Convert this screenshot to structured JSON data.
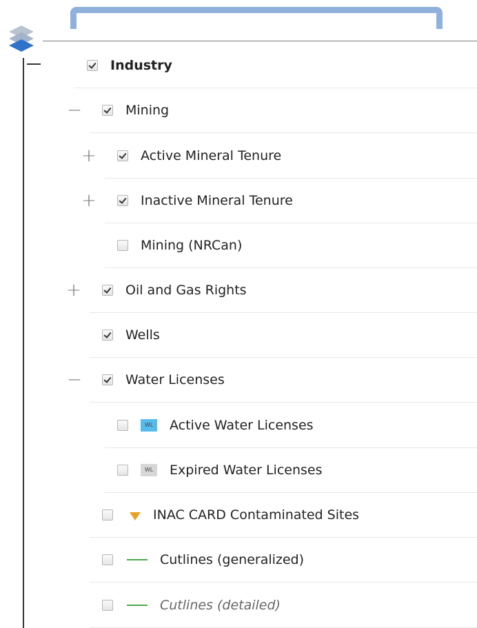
{
  "tree": {
    "root": {
      "label": "Industry",
      "checked": true
    },
    "items": [
      {
        "label": "Mining",
        "checked": true,
        "expander": "minus"
      },
      {
        "label": "Active Mineral Tenure",
        "checked": true,
        "expander": "plus"
      },
      {
        "label": "Inactive Mineral Tenure",
        "checked": true,
        "expander": "plus"
      },
      {
        "label": "Mining (NRCan)",
        "checked": false
      },
      {
        "label": "Oil and Gas Rights",
        "checked": true,
        "expander": "plus"
      },
      {
        "label": "Wells",
        "checked": true
      },
      {
        "label": "Water Licenses",
        "checked": true,
        "expander": "minus"
      },
      {
        "label": "Active Water Licenses",
        "checked": false,
        "icon": "active-water-license-icon",
        "icon_text": "WL"
      },
      {
        "label": "Expired Water Licenses",
        "checked": false,
        "icon": "expired-water-license-icon",
        "icon_text": "WL"
      },
      {
        "label": "INAC CARD Contaminated Sites",
        "checked": false,
        "icon": "contaminated-site-triangle-icon"
      },
      {
        "label": "Cutlines (generalized)",
        "checked": false,
        "icon": "green-line-icon"
      },
      {
        "label": "Cutlines (detailed)",
        "checked": false,
        "icon": "green-line-icon"
      }
    ]
  },
  "expander_symbols": {
    "minus": "−",
    "plus": "+"
  },
  "colors": {
    "tab_border": "#8fb1dc",
    "active_wl": "#55bbee",
    "expired_wl": "#d7d7d7",
    "triangle": "#e7a325",
    "line": "#4fa54a"
  }
}
